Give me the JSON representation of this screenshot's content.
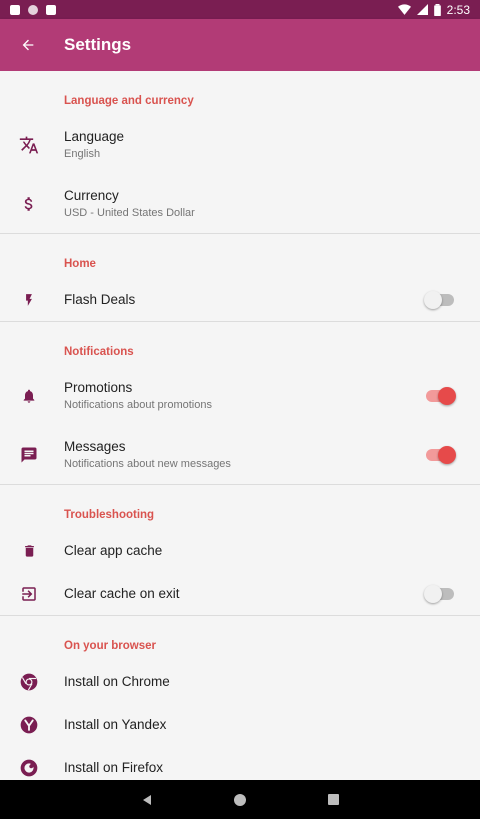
{
  "status_bar": {
    "time": "2:53"
  },
  "app_bar": {
    "title": "Settings"
  },
  "sections": {
    "language_currency": {
      "header": "Language and currency",
      "language": {
        "label": "Language",
        "value": "English"
      },
      "currency": {
        "label": "Currency",
        "value": "USD - United States Dollar"
      }
    },
    "home": {
      "header": "Home",
      "flash_deals": {
        "label": "Flash Deals",
        "enabled": false
      }
    },
    "notifications": {
      "header": "Notifications",
      "promotions": {
        "label": "Promotions",
        "description": "Notifications about promotions",
        "enabled": true
      },
      "messages": {
        "label": "Messages",
        "description": "Notifications about new messages",
        "enabled": true
      }
    },
    "troubleshooting": {
      "header": "Troubleshooting",
      "clear_cache": {
        "label": "Clear app cache"
      },
      "clear_on_exit": {
        "label": "Clear cache on exit",
        "enabled": false
      }
    },
    "browser": {
      "header": "On your browser",
      "chrome": {
        "label": "Install on Chrome"
      },
      "yandex": {
        "label": "Install on Yandex"
      },
      "firefox": {
        "label": "Install on Firefox"
      }
    }
  },
  "colors": {
    "primary": "#b23b76",
    "primary_dark": "#7a1e52",
    "accent": "#e64a4a",
    "icon": "#7a1e52",
    "section_header": "#d9534f"
  },
  "icons": [
    "translate-icon",
    "dollar-icon",
    "flash-icon",
    "bell-icon",
    "message-icon",
    "trash-icon",
    "exit-icon",
    "chrome-icon",
    "yandex-icon",
    "firefox-icon"
  ]
}
